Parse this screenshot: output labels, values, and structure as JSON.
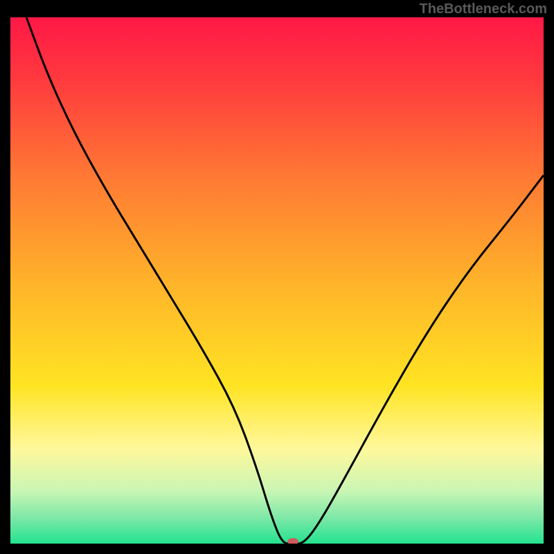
{
  "watermark": "TheBottleneck.com",
  "chart_data": {
    "type": "line",
    "title": "",
    "xlabel": "",
    "ylabel": "",
    "xlim": [
      0,
      100
    ],
    "ylim": [
      0,
      100
    ],
    "background_gradient": {
      "stops": [
        {
          "offset": 0.0,
          "color": "#ff1846"
        },
        {
          "offset": 0.12,
          "color": "#ff3a3e"
        },
        {
          "offset": 0.3,
          "color": "#ff7834"
        },
        {
          "offset": 0.5,
          "color": "#ffb22a"
        },
        {
          "offset": 0.7,
          "color": "#ffe423"
        },
        {
          "offset": 0.82,
          "color": "#fff89c"
        },
        {
          "offset": 0.9,
          "color": "#c9f6b4"
        },
        {
          "offset": 0.95,
          "color": "#7fe8a8"
        },
        {
          "offset": 1.0,
          "color": "#23e38f"
        }
      ]
    },
    "series": [
      {
        "name": "bottleneck-curve",
        "color": "#000000",
        "x": [
          3,
          7,
          12,
          18,
          24,
          30,
          36,
          42,
          46,
          49,
          51,
          53,
          55,
          58,
          63,
          70,
          78,
          86,
          94,
          100
        ],
        "y": [
          100,
          89,
          78,
          67,
          57,
          47,
          37,
          26,
          15,
          5,
          0,
          0,
          0,
          4,
          13,
          26,
          40,
          52,
          62,
          70
        ]
      }
    ],
    "marker": {
      "name": "bottleneck-point",
      "x": 53,
      "y": 0,
      "color": "#cf5a5f",
      "rx": 8,
      "ry": 5
    }
  }
}
